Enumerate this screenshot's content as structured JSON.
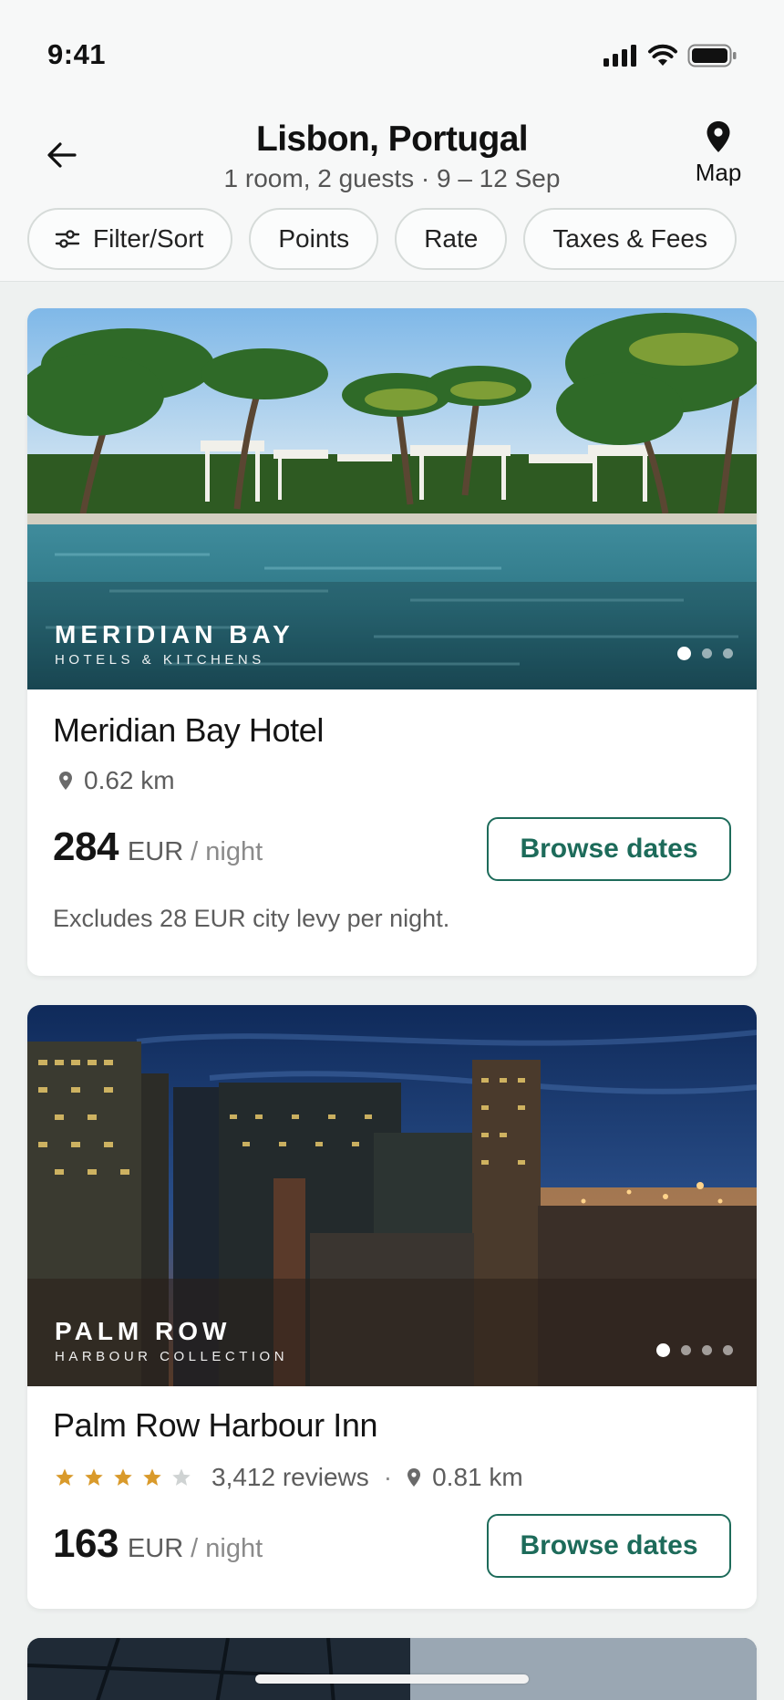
{
  "status_bar": {
    "time": "9:41"
  },
  "header": {
    "title": "Lisbon, Portugal",
    "subtitle": "1 room, 2 guests · 9 – 12 Sep",
    "map_label": "Map"
  },
  "chips": [
    {
      "label": "Filter/Sort",
      "icon": "sliders-icon"
    },
    {
      "label": "Points"
    },
    {
      "label": "Rate"
    },
    {
      "label": "Taxes & Fees"
    }
  ],
  "hotels": [
    {
      "brand_name": "MERIDIAN BAY",
      "brand_sub": "HOTELS & KITCHENS",
      "name": "Meridian Bay Hotel",
      "distance": "0.62 km",
      "price": "284",
      "currency": "EUR",
      "per_night": "/ night",
      "button": "Browse dates",
      "note": "Excludes 28 EUR city levy per night.",
      "image_dots": 3,
      "active_dot": 0
    },
    {
      "brand_name": "PALM ROW",
      "brand_sub": "HARBOUR COLLECTION",
      "name": "Palm Row Harbour Inn",
      "rating": 4,
      "rating_max": 5,
      "reviews": "3,412 reviews",
      "distance": "0.81 km",
      "price": "163",
      "currency": "EUR",
      "per_night": "/ night",
      "button": "Browse dates",
      "image_dots": 4,
      "active_dot": 0
    }
  ],
  "colors": {
    "accent": "#1d6b5a",
    "star": "#d99a2b",
    "star_empty": "#cfd3d3",
    "background": "#eef1f0"
  }
}
